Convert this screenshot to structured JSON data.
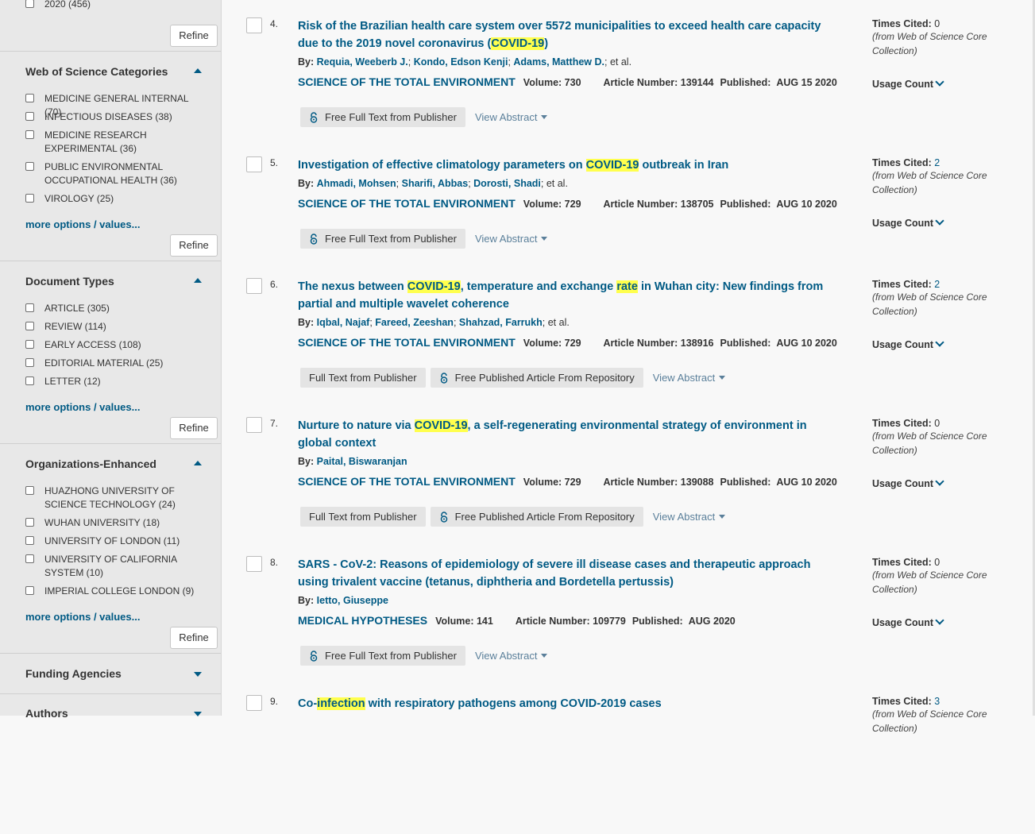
{
  "sidebar": {
    "top_item": "2020 (456)",
    "refine_label": "Refine",
    "more_label": "more options / values...",
    "categories": {
      "title": "Web of Science Categories",
      "items": [
        "MEDICINE GENERAL INTERNAL (70)",
        "INFECTIOUS DISEASES (38)",
        "MEDICINE RESEARCH EXPERIMENTAL (36)",
        "PUBLIC ENVIRONMENTAL OCCUPATIONAL HEALTH (36)",
        "VIROLOGY (25)"
      ]
    },
    "doc_types": {
      "title": "Document Types",
      "items": [
        "ARTICLE (305)",
        "REVIEW (114)",
        "EARLY ACCESS (108)",
        "EDITORIAL MATERIAL (25)",
        "LETTER (12)"
      ]
    },
    "orgs": {
      "title": "Organizations-Enhanced",
      "items": [
        "HUAZHONG UNIVERSITY OF SCIENCE TECHNOLOGY (24)",
        "WUHAN UNIVERSITY (18)",
        "UNIVERSITY OF LONDON (11)",
        "UNIVERSITY OF CALIFORNIA SYSTEM (10)",
        "IMPERIAL COLLEGE LONDON (9)"
      ]
    },
    "funding": {
      "title": "Funding Agencies"
    },
    "authors": {
      "title": "Authors"
    }
  },
  "labels": {
    "by": "By:",
    "et_al": "; et al.",
    "volume": "Volume:",
    "article_number": "Article Number:",
    "published": "Published:",
    "times_cited": "Times Cited:",
    "cited_source": "(from Web of Science Core Collection)",
    "usage_count": "Usage Count",
    "view_abstract": "View Abstract",
    "free_full_text": "Free Full Text from Publisher",
    "full_text": "Full Text from Publisher",
    "free_repo": "Free Published Article From Repository"
  },
  "records": [
    {
      "num": "4.",
      "title_parts": [
        [
          "Risk of the Brazilian health care system over 5572 municipalities to exceed health care capacity due to the 2019 novel coronavirus (",
          false
        ],
        [
          "COVID-19",
          true
        ],
        [
          ")",
          false
        ]
      ],
      "authors": [
        "Requia, Weeberb J.",
        "Kondo, Edson Kenji",
        "Adams, Matthew D."
      ],
      "journal": "SCIENCE OF THE TOTAL ENVIRONMENT",
      "volume": "730",
      "article_number": "139144",
      "published": "AUG 15 2020",
      "times_cited": "0",
      "buttons": [
        "free_full_text"
      ]
    },
    {
      "num": "5.",
      "title_parts": [
        [
          "Investigation of effective climatology parameters on ",
          false
        ],
        [
          "COVID-19",
          true
        ],
        [
          " outbreak in Iran",
          false
        ]
      ],
      "authors": [
        "Ahmadi, Mohsen",
        "Sharifi, Abbas",
        "Dorosti, Shadi"
      ],
      "journal": "SCIENCE OF THE TOTAL ENVIRONMENT",
      "volume": "729",
      "article_number": "138705",
      "published": "AUG 10 2020",
      "times_cited": "2",
      "buttons": [
        "free_full_text"
      ]
    },
    {
      "num": "6.",
      "title_parts": [
        [
          "The nexus between ",
          false
        ],
        [
          "COVID-19",
          true
        ],
        [
          ", temperature and exchange ",
          false
        ],
        [
          "rate",
          true
        ],
        [
          " in Wuhan city: New findings from partial and multiple wavelet coherence",
          false
        ]
      ],
      "authors": [
        "Iqbal, Najaf",
        "Fareed, Zeeshan",
        "Shahzad, Farrukh"
      ],
      "journal": "SCIENCE OF THE TOTAL ENVIRONMENT",
      "volume": "729",
      "article_number": "138916",
      "published": "AUG 10 2020",
      "times_cited": "2",
      "buttons": [
        "full_text",
        "free_repo"
      ]
    },
    {
      "num": "7.",
      "title_parts": [
        [
          "Nurture to nature via ",
          false
        ],
        [
          "COVID-19",
          true
        ],
        [
          ", a self-regenerating environmental strategy of environment in global context",
          false
        ]
      ],
      "authors": [
        "Paital, Biswaranjan"
      ],
      "journal": "SCIENCE OF THE TOTAL ENVIRONMENT",
      "volume": "729",
      "article_number": "139088",
      "published": "AUG 10 2020",
      "times_cited": "0",
      "buttons": [
        "full_text",
        "free_repo"
      ]
    },
    {
      "num": "8.",
      "title_parts": [
        [
          "SARS - CoV-2: Reasons of epidemiology of severe ill disease cases and therapeutic approach using trivalent vaccine (tetanus, diphtheria and Bordetella pertussis)",
          false
        ]
      ],
      "authors": [
        "Ietto, Giuseppe"
      ],
      "journal": "MEDICAL HYPOTHESES",
      "volume": "141",
      "article_number": "109779",
      "published": "AUG 2020",
      "times_cited": "0",
      "buttons": [
        "free_full_text"
      ]
    },
    {
      "num": "9.",
      "title_parts": [
        [
          "Co-",
          false
        ],
        [
          "infection",
          true
        ],
        [
          " with respiratory pathogens among COVID-2019 cases",
          false
        ]
      ],
      "authors": [],
      "journal": "",
      "volume": "",
      "article_number": "",
      "published": "",
      "times_cited": "3",
      "buttons": []
    }
  ]
}
